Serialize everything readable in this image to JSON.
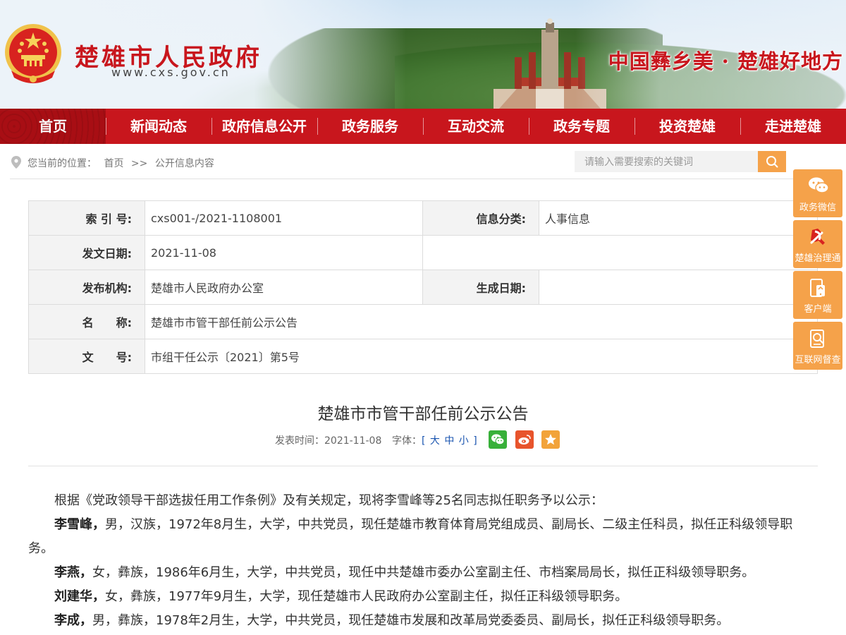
{
  "header": {
    "site_title": "楚雄市人民政府",
    "site_url": "www.cxs.gov.cn",
    "slogan": "中国彝乡美 · 楚雄好地方"
  },
  "nav": {
    "items": [
      "首页",
      "新闻动态",
      "政府信息公开",
      "政务服务",
      "互动交流",
      "政务专题",
      "投资楚雄",
      "走进楚雄"
    ],
    "active_index": 0
  },
  "breadcrumb": {
    "prefix": "您当前的位置：",
    "home": "首页",
    "separator": ">>",
    "current": "公开信息内容"
  },
  "search": {
    "placeholder": "请输入需要搜索的关键词"
  },
  "info": {
    "index_label": "索 引 号:",
    "index_value": "cxs001-/2021-1108001",
    "category_label": "信息分类:",
    "category_value": "人事信息",
    "date_label": "发文日期:",
    "date_value": "2021-11-08",
    "org_label": "发布机构:",
    "org_value": "楚雄市人民政府办公室",
    "effective_label": "生成日期:",
    "effective_value": "",
    "name_label": "名　　称:",
    "name_value": "楚雄市市管干部任前公示公告",
    "doc_label": "文　　号:",
    "doc_value": "市组干任公示〔2021〕第5号"
  },
  "article": {
    "title": "楚雄市市管干部任前公示公告",
    "publish_label": "发表时间：",
    "publish_date": "2021-11-08",
    "font_label": "字体：",
    "font_sizes": "[ 大 中 小 ]",
    "paragraphs": [
      {
        "lead": "",
        "text": "根据《党政领导干部选拔任用工作条例》及有关规定，现将李雪峰等25名同志拟任职务予以公示："
      },
      {
        "lead": "李雪峰，",
        "text": "男，汉族，1972年8月生，大学，中共党员，现任楚雄市教育体育局党组成员、副局长、二级主任科员，拟任正科级领导职务。"
      },
      {
        "lead": "李燕，",
        "text": "女，彝族，1986年6月生，大学，中共党员，现任中共楚雄市委办公室副主任、市档案局局长，拟任正科级领导职务。"
      },
      {
        "lead": "刘建华，",
        "text": "女，彝族，1977年9月生，大学，现任楚雄市人民政府办公室副主任，拟任正科级领导职务。"
      },
      {
        "lead": "李成，",
        "text": "男，彝族，1978年2月生，大学，中共党员，现任楚雄市发展和改革局党委委员、副局长，拟任正科级领导职务。"
      }
    ]
  },
  "side": {
    "items": [
      "政务微信",
      "楚雄治理通",
      "客户端",
      "互联网督查"
    ]
  },
  "colors": {
    "brand_red": "#c8161d",
    "accent_orange": "#f5a24a"
  }
}
